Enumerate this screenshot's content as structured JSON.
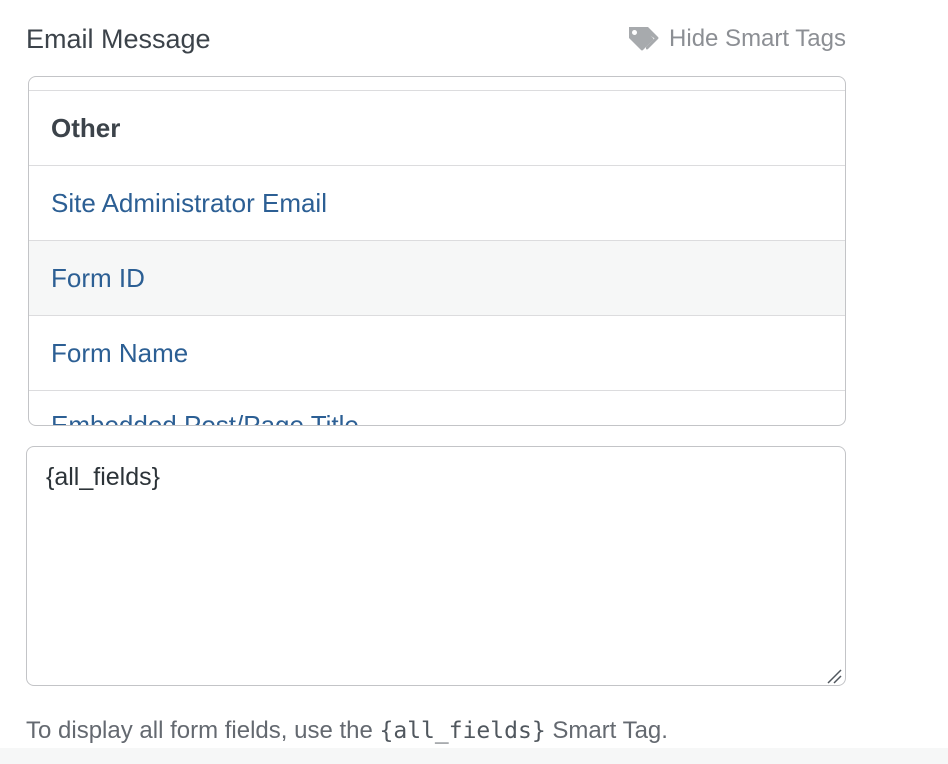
{
  "field": {
    "label": "Email Message",
    "toggle_label": "Hide Smart Tags",
    "toggle_icon": "tags-icon"
  },
  "smart_tags": {
    "group_heading": "Other",
    "items": [
      "Site Administrator Email",
      "Form ID",
      "Form Name",
      "Embedded Post/Page Title"
    ],
    "hovered_index": 1
  },
  "message": {
    "value": "{all_fields}"
  },
  "description": {
    "prefix": "To display all form fields, use the ",
    "code": "{all_fields}",
    "suffix": " Smart Tag."
  },
  "colors": {
    "link": "#2c5f94",
    "hover_bg": "#f6f7f7",
    "border": "#c3c4c7",
    "muted": "#8c8f94"
  }
}
